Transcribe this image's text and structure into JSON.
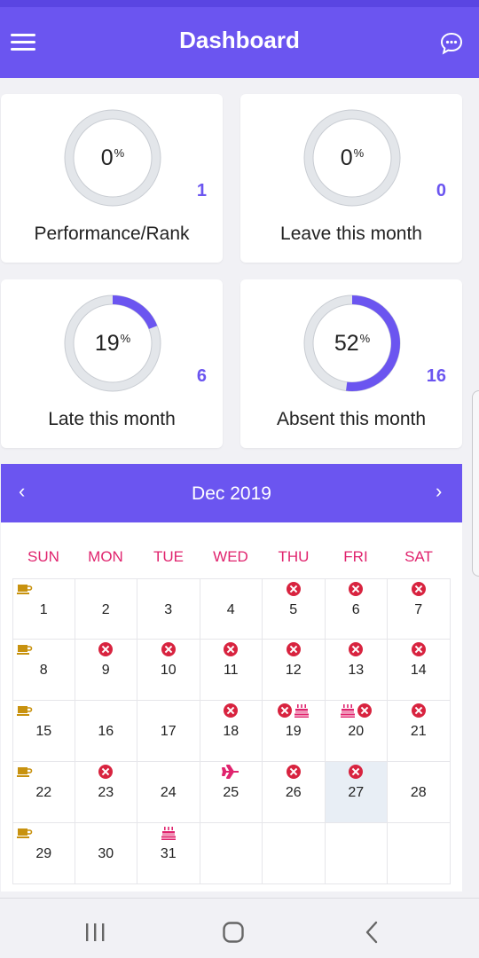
{
  "appbar": {
    "title": "Dashboard"
  },
  "cards": [
    {
      "percent": "0",
      "percent_suffix": "%",
      "count": "1",
      "label": "Performance/Rank",
      "fraction": 0
    },
    {
      "percent": "0",
      "percent_suffix": "%",
      "count": "0",
      "label": "Leave this month",
      "fraction": 0
    },
    {
      "percent": "19",
      "percent_suffix": "%",
      "count": "6",
      "label": "Late this month",
      "fraction": 0.19
    },
    {
      "percent": "52",
      "percent_suffix": "%",
      "count": "16",
      "label": "Absent this month",
      "fraction": 0.52
    }
  ],
  "calendar": {
    "month_label": "Dec 2019",
    "prev_label": "‹",
    "next_label": "›",
    "weekdays": [
      "SUN",
      "MON",
      "TUE",
      "WED",
      "THU",
      "FRI",
      "SAT"
    ],
    "days": [
      {
        "day": "1",
        "icons": [
          "coffee"
        ]
      },
      {
        "day": "2",
        "icons": []
      },
      {
        "day": "3",
        "icons": []
      },
      {
        "day": "4",
        "icons": []
      },
      {
        "day": "5",
        "icons": [
          "absent"
        ]
      },
      {
        "day": "6",
        "icons": [
          "absent"
        ]
      },
      {
        "day": "7",
        "icons": [
          "absent"
        ]
      },
      {
        "day": "8",
        "icons": [
          "coffee"
        ]
      },
      {
        "day": "9",
        "icons": [
          "absent"
        ]
      },
      {
        "day": "10",
        "icons": [
          "absent"
        ]
      },
      {
        "day": "11",
        "icons": [
          "absent"
        ]
      },
      {
        "day": "12",
        "icons": [
          "absent"
        ]
      },
      {
        "day": "13",
        "icons": [
          "absent"
        ]
      },
      {
        "day": "14",
        "icons": [
          "absent"
        ]
      },
      {
        "day": "15",
        "icons": [
          "coffee"
        ]
      },
      {
        "day": "16",
        "icons": []
      },
      {
        "day": "17",
        "icons": []
      },
      {
        "day": "18",
        "icons": [
          "absent"
        ]
      },
      {
        "day": "19",
        "icons": [
          "absent",
          "cake"
        ]
      },
      {
        "day": "20",
        "icons": [
          "cake",
          "absent"
        ]
      },
      {
        "day": "21",
        "icons": [
          "absent"
        ]
      },
      {
        "day": "22",
        "icons": [
          "coffee"
        ]
      },
      {
        "day": "23",
        "icons": [
          "absent"
        ]
      },
      {
        "day": "24",
        "icons": []
      },
      {
        "day": "25",
        "icons": [
          "plane"
        ]
      },
      {
        "day": "26",
        "icons": [
          "absent"
        ]
      },
      {
        "day": "27",
        "icons": [
          "absent"
        ],
        "today": true
      },
      {
        "day": "28",
        "icons": []
      },
      {
        "day": "29",
        "icons": [
          "coffee"
        ]
      },
      {
        "day": "30",
        "icons": []
      },
      {
        "day": "31",
        "icons": [
          "cake"
        ]
      },
      {
        "day": "",
        "icons": []
      },
      {
        "day": "",
        "icons": []
      },
      {
        "day": "",
        "icons": []
      },
      {
        "day": "",
        "icons": []
      }
    ]
  },
  "colors": {
    "accent": "#6b55f0",
    "weekday": "#e0246e",
    "absent": "#d8233f",
    "coffee": "#c8920f",
    "holiday": "#e0246e",
    "today_bg": "#e8eef5"
  },
  "icons": {
    "menu": "hamburger-icon",
    "chat": "chat-bubble-icon",
    "absent": "absent-x-icon",
    "coffee": "coffee-cup-icon",
    "cake": "birthday-cake-icon",
    "plane": "airplane-icon"
  }
}
